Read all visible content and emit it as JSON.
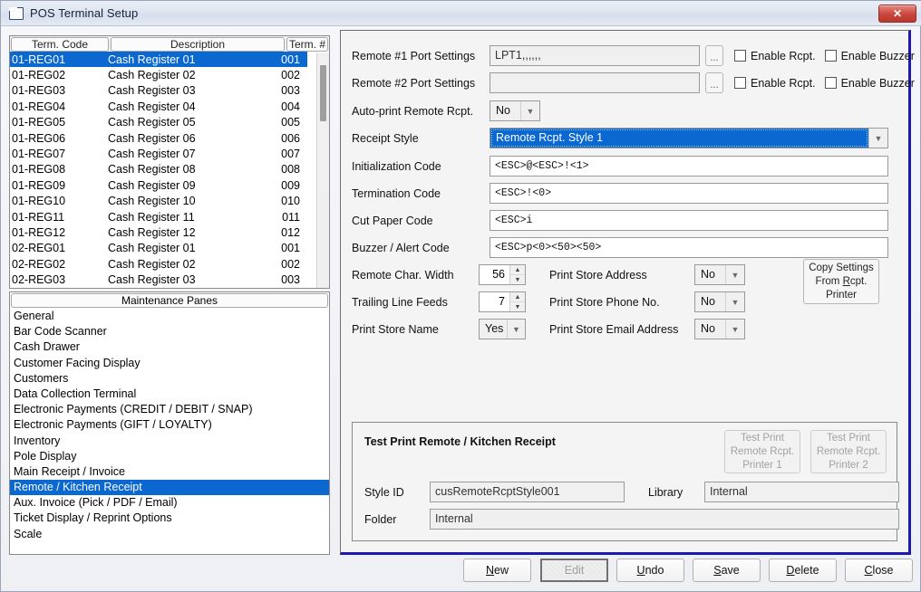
{
  "window": {
    "title": "POS Terminal Setup",
    "icon": "window-icon",
    "close_label": "✕"
  },
  "terminal_list": {
    "columns": [
      "Term. Code",
      "Description",
      "Term. #"
    ],
    "rows": [
      {
        "code": "01-REG01",
        "desc": "Cash Register 01",
        "num": "001",
        "selected": true
      },
      {
        "code": "01-REG02",
        "desc": "Cash Register 02",
        "num": "002",
        "selected": false
      },
      {
        "code": "01-REG03",
        "desc": "Cash Register 03",
        "num": "003",
        "selected": false
      },
      {
        "code": "01-REG04",
        "desc": "Cash Register 04",
        "num": "004",
        "selected": false
      },
      {
        "code": "01-REG05",
        "desc": "Cash Register 05",
        "num": "005",
        "selected": false
      },
      {
        "code": "01-REG06",
        "desc": "Cash Register 06",
        "num": "006",
        "selected": false
      },
      {
        "code": "01-REG07",
        "desc": "Cash Register 07",
        "num": "007",
        "selected": false
      },
      {
        "code": "01-REG08",
        "desc": "Cash Register 08",
        "num": "008",
        "selected": false
      },
      {
        "code": "01-REG09",
        "desc": "Cash Register 09",
        "num": "009",
        "selected": false
      },
      {
        "code": "01-REG10",
        "desc": "Cash Register 10",
        "num": "010",
        "selected": false
      },
      {
        "code": "01-REG11",
        "desc": "Cash Register 11",
        "num": "011",
        "selected": false
      },
      {
        "code": "01-REG12",
        "desc": "Cash Register 12",
        "num": "012",
        "selected": false
      },
      {
        "code": "02-REG01",
        "desc": "Cash Register 01",
        "num": "001",
        "selected": false
      },
      {
        "code": "02-REG02",
        "desc": "Cash Register 02",
        "num": "002",
        "selected": false
      },
      {
        "code": "02-REG03",
        "desc": "Cash Register 03",
        "num": "003",
        "selected": false
      }
    ]
  },
  "maintenance_panes": {
    "header": "Maintenance Panes",
    "items": [
      {
        "label": "General",
        "selected": false
      },
      {
        "label": "Bar Code Scanner",
        "selected": false
      },
      {
        "label": "Cash Drawer",
        "selected": false
      },
      {
        "label": "Customer Facing Display",
        "selected": false
      },
      {
        "label": "Customers",
        "selected": false
      },
      {
        "label": "Data Collection Terminal",
        "selected": false
      },
      {
        "label": "Electronic Payments (CREDIT / DEBIT / SNAP)",
        "selected": false
      },
      {
        "label": "Electronic Payments (GIFT /  LOYALTY)",
        "selected": false
      },
      {
        "label": "Inventory",
        "selected": false
      },
      {
        "label": "Pole Display",
        "selected": false
      },
      {
        "label": "Main Receipt / Invoice",
        "selected": false
      },
      {
        "label": "Remote / Kitchen Receipt",
        "selected": true
      },
      {
        "label": "Aux. Invoice (Pick / PDF / Email)",
        "selected": false
      },
      {
        "label": "Ticket Display / Reprint Options",
        "selected": false
      },
      {
        "label": "Scale",
        "selected": false
      }
    ]
  },
  "form": {
    "remote1_label": "Remote #1 Port Settings",
    "remote1_value": "LPT1,,,,,,",
    "remote1_browse": "...",
    "remote1_rcpt_label": "Enable Rcpt.",
    "remote1_buzzer_label": "Enable Buzzer",
    "remote2_label": "Remote #2 Port Settings",
    "remote2_value": "",
    "remote2_browse": "...",
    "remote2_rcpt_label": "Enable Rcpt.",
    "remote2_buzzer_label": "Enable Buzzer",
    "autoprint_label": "Auto-print Remote Rcpt.",
    "autoprint_value": "No",
    "receipt_style_label": "Receipt Style",
    "receipt_style_value": "Remote Rcpt. Style 1",
    "init_code_label": "Initialization Code",
    "init_code_value": "<ESC>@<ESC>!<1>",
    "term_code_label": "Termination Code",
    "term_code_value": "<ESC>!<0>",
    "cut_code_label": "Cut Paper Code",
    "cut_code_value": "<ESC>i",
    "buzzer_code_label": "Buzzer / Alert Code",
    "buzzer_code_value": "<ESC>p<0><50><50>",
    "char_width_label": "Remote Char. Width",
    "char_width_value": "56",
    "trailing_feeds_label": "Trailing Line Feeds",
    "trailing_feeds_value": "7",
    "print_store_name_label": "Print Store Name",
    "print_store_name_value": "Yes",
    "print_address_label": "Print Store Address",
    "print_address_value": "No",
    "print_phone_label": "Print Store Phone No.",
    "print_phone_value": "No",
    "print_email_label": "Print Store Email Address",
    "print_email_value": "No",
    "copy_settings_line1": "Copy Settings",
    "copy_settings_line2a": "From ",
    "copy_settings_line2b": "R",
    "copy_settings_line2c": "cpt.",
    "copy_settings_line3": "Printer"
  },
  "test_print": {
    "title": "Test Print Remote / Kitchen Receipt",
    "btn1_line1": "Test Print",
    "btn1_line2": "Remote Rcpt.",
    "btn1_line3": "Printer 1",
    "btn2_line1": "Test Print",
    "btn2_line2": "Remote Rcpt.",
    "btn2_line3": "Printer 2",
    "style_id_label": "Style ID",
    "style_id_value": "cusRemoteRcptStyle001",
    "library_label": "Library",
    "library_value": "Internal",
    "folder_label": "Folder",
    "folder_value": "Internal"
  },
  "buttons": {
    "new": {
      "pre": "",
      "key": "N",
      "post": "ew",
      "disabled": false
    },
    "edit": {
      "pre": "",
      "key": "E",
      "post": "dit",
      "disabled": true
    },
    "undo": {
      "pre": "",
      "key": "U",
      "post": "ndo",
      "disabled": false
    },
    "save": {
      "pre": "",
      "key": "S",
      "post": "ave",
      "disabled": false
    },
    "delete": {
      "pre": "",
      "key": "D",
      "post": "elete",
      "disabled": false
    },
    "close": {
      "pre": "",
      "key": "C",
      "post": "lose",
      "disabled": false
    }
  },
  "colors": {
    "selection_blue": "#0a68d0",
    "panel_border_blue": "#1a1ab0",
    "close_red": "#c9453b"
  }
}
